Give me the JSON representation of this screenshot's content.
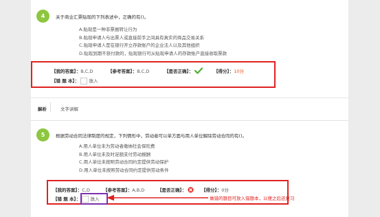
{
  "q4": {
    "number": "4",
    "stem": "关于商业汇票贴现的下列表述中，正确的有()。",
    "options": [
      "A.贴现是一种非票据转让行为",
      "B.贴现申请人与出票人或直接前手之间具有真实的商品交易关系",
      "C.贴现申请人是在银行开立存款账户的企业法人以及其他组织",
      "D.贴现到期不获付款的，贴现银行可从贴现申请人的存款账户直接收取票款"
    ],
    "my_answer_label": "【我的答案】：",
    "my_answer": "B,C,D",
    "ref_answer_label": "【参考答案】：",
    "ref_answer": "B,C,D",
    "correct_label": "【是否正确】：",
    "score_label": "【得分】：",
    "score": "10分",
    "wrongbook_label": "【错 题 本】：",
    "wrongbook_action": "放入"
  },
  "explain": {
    "tag": "解析",
    "link": "文字讲解"
  },
  "q5": {
    "number": "5",
    "stem": "根据劳动合同法律制度的规定，下列情形中，劳动者可以单方面与用人单位解除劳动合同的有()。",
    "options": [
      "A.用人单位未为劳动者缴纳社会保险费",
      "B.用人单位未及时足额支付劳动报酬",
      "C.用人单位未按照劳动合同约定提供劳动保护",
      "D.用人单位未按照劳动合同约定提供劳动条件"
    ],
    "my_answer_label": "【我的答案】：",
    "my_answer": "C,D",
    "ref_answer_label": "【参考答案】：",
    "ref_answer": "A,B,D",
    "correct_label": "【是否正确】：",
    "score_label": "【得分】：",
    "score": "0分",
    "wrongbook_label": "【错 题 本】：",
    "wrongbook_action": "放入"
  },
  "annotation": {
    "note": "做错的题目可放入错题本，以便之后还复习"
  },
  "colors": {
    "qnum_bg": "#8dc63f",
    "correct": "#4cae2c",
    "wrong": "#e0302a",
    "red_frame": "#e02020",
    "purple_frame": "#7b2fb0"
  },
  "icons": {
    "correct": "check-icon",
    "wrong": "x-circle-icon",
    "arrow": "arrow-left-icon"
  }
}
